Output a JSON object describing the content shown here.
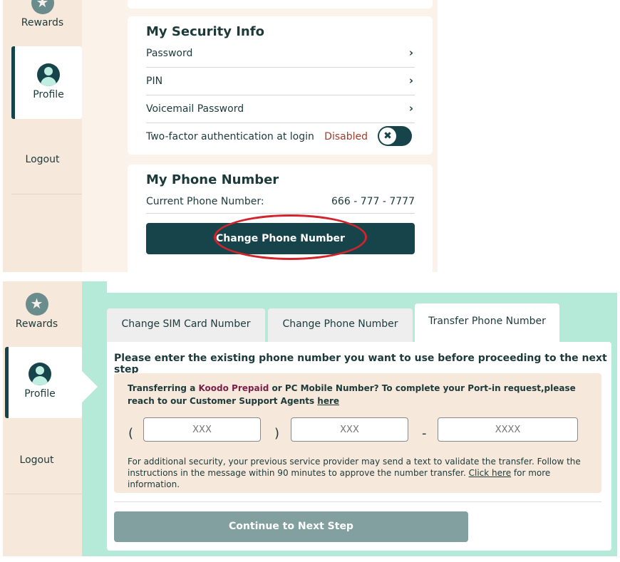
{
  "sidebar": {
    "rewards": "Rewards",
    "profile": "Profile",
    "logout": "Logout"
  },
  "security": {
    "title": "My Security Info",
    "rows": [
      "Password",
      "PIN",
      "Voicemail Password"
    ],
    "two_factor_label": "Two-factor authentication at login",
    "two_factor_status": "Disabled",
    "toggle_symbol": "✖"
  },
  "phone": {
    "title": "My Phone Number",
    "current_label": "Current Phone Number:",
    "current_value": "666 - 777 - 7777",
    "change_button": "Change Phone Number"
  },
  "tabs": [
    {
      "label": "Change SIM Card Number",
      "active": false
    },
    {
      "label": "Change Phone Number",
      "active": false
    },
    {
      "label": "Transfer Phone Number",
      "active": true
    }
  ],
  "transfer": {
    "instruction": "Please enter the existing phone number you want to use before proceeding to the next step",
    "info_prefix": "Transferring a ",
    "info_brand": "Koodo Prepaid",
    "info_middle": " or PC Mobile Number? To complete your Port-in request,please reach to our Customer Support Agents ",
    "info_link": "here",
    "paren_open": "(",
    "paren_close": ")",
    "dash": "-",
    "area_placeholder": "XXX",
    "prefix_placeholder": "XXX",
    "line_placeholder": "XXXX",
    "fine_print_prefix": "For additional security, your previous service provider may send a text to validate the transfer. Follow the instructions in the message within 90 minutes to approve the number transfer. ",
    "fine_print_link": "Click here",
    "fine_print_suffix": " for more information.",
    "continue_button": "Continue to Next Step"
  },
  "colors": {
    "dark_teal": "#17444a",
    "mint": "#b6ead8",
    "beige": "#f6e8da",
    "disabled_red": "#a33b2a",
    "highlight_oval": "#d1242b",
    "continue_disabled": "#83a0a0"
  }
}
